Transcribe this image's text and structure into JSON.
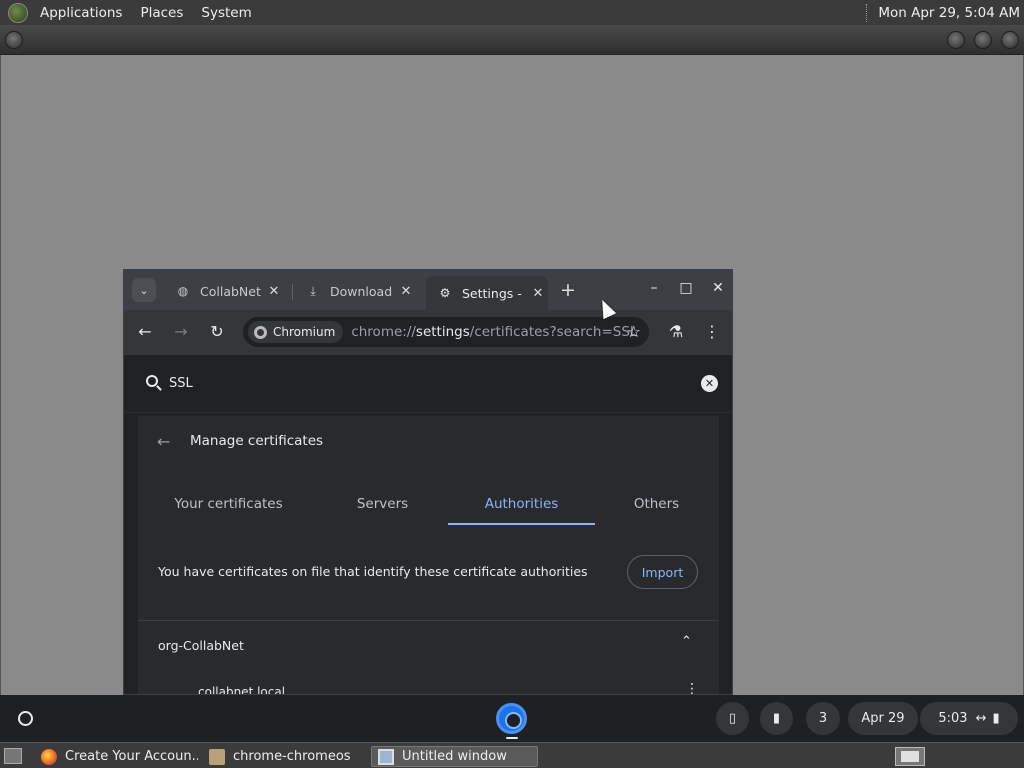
{
  "top_panel": {
    "menus": [
      "Applications",
      "Places",
      "System"
    ],
    "clock": "Mon Apr 29, 5:04 AM"
  },
  "chromium": {
    "tab_search_icon": "chevron-down-icon",
    "tabs": [
      {
        "title": "CollabNet",
        "icon": "globe-icon",
        "active": false
      },
      {
        "title": "Download",
        "icon": "download-icon",
        "active": false
      },
      {
        "title": "Settings - ",
        "icon": "gear-icon",
        "active": true
      }
    ],
    "omnibox": {
      "chip": "Chromium",
      "url_prefix": "chrome://",
      "url_host": "settings",
      "url_rest": "/certificates?search=SSL"
    }
  },
  "settings": {
    "search_value": "SSL",
    "heading": "Manage certificates",
    "tabs": [
      "Your certificates",
      "Servers",
      "Authorities",
      "Others"
    ],
    "active_tab": "Authorities",
    "info_text": "You have certificates on file that identify these certificate authorities",
    "import_label": "Import",
    "org": "org-CollabNet",
    "sub_item": "collabnet.local"
  },
  "shelf": {
    "notifications": "3",
    "date": "Apr 29",
    "time": "5:03"
  },
  "bottom_panel": {
    "tasks": [
      "Create Your Accoun...",
      "chrome-chromeos",
      "Untitled window"
    ]
  },
  "colors": {
    "accent": "#8ab4f8",
    "chrome_bg": "#202124",
    "card_bg": "#292a2d"
  }
}
